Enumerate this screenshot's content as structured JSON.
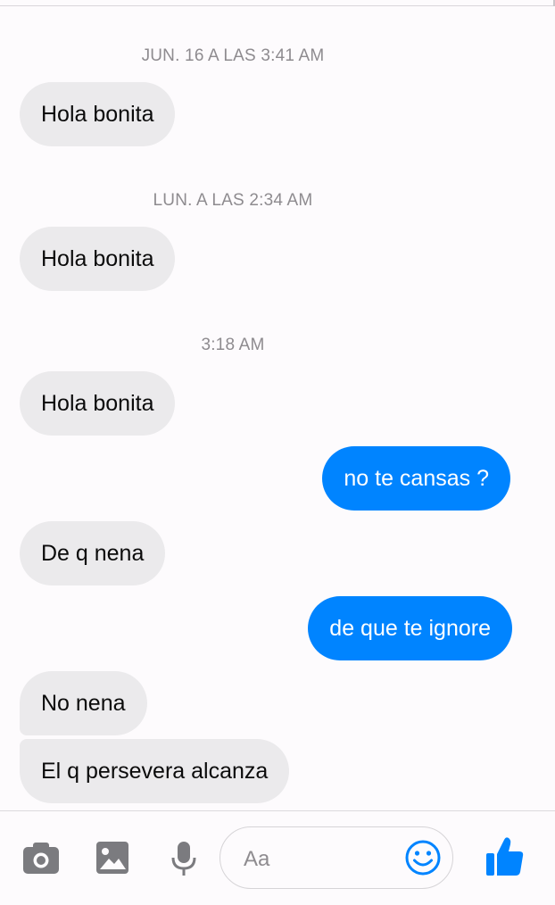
{
  "conversation": {
    "timestamps": [
      "JUN. 16 A LAS 3:41 AM",
      "LUN. A LAS 2:34 AM",
      "3:18 AM"
    ],
    "messages": [
      {
        "from": "them",
        "text": "Hola bonita"
      },
      {
        "from": "them",
        "text": "Hola bonita"
      },
      {
        "from": "them",
        "text": "Hola bonita"
      },
      {
        "from": "me",
        "text": "no te cansas ?"
      },
      {
        "from": "them",
        "text": "De q nena"
      },
      {
        "from": "me",
        "text": "de que te ignore"
      },
      {
        "from": "them",
        "text": "No nena"
      },
      {
        "from": "them",
        "text": "El q persevera alcanza"
      }
    ]
  },
  "composer": {
    "placeholder": "Aa",
    "icons": [
      "camera-icon",
      "image-icon",
      "microphone-icon",
      "emoji-icon",
      "thumbs-up-icon"
    ]
  },
  "colors": {
    "accent": "#0084ff",
    "incoming_bubble": "#ebeaec",
    "timestamp": "#8e8b8f",
    "icon_gray": "#7b7b7f"
  }
}
